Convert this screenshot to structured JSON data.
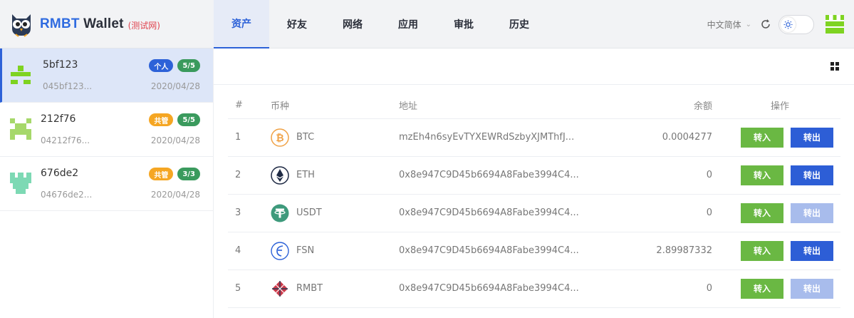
{
  "brand": {
    "title_a": "RMBT",
    "title_b": " Wallet",
    "network": "(测试网)"
  },
  "nav": {
    "tabs": [
      {
        "label": "资产"
      },
      {
        "label": "好友"
      },
      {
        "label": "网络"
      },
      {
        "label": "应用"
      },
      {
        "label": "审批"
      },
      {
        "label": "历史"
      }
    ]
  },
  "tools": {
    "language": "中文简体"
  },
  "accounts": [
    {
      "name": "5bf123",
      "address": "045bf123...",
      "date": "2020/04/28",
      "badge_type": "个人",
      "badge_count": "5/5"
    },
    {
      "name": "212f76",
      "address": "04212f76...",
      "date": "2020/04/28",
      "badge_type": "共管",
      "badge_count": "5/5"
    },
    {
      "name": "676de2",
      "address": "04676de2...",
      "date": "2020/04/28",
      "badge_type": "共管",
      "badge_count": "3/3"
    }
  ],
  "table": {
    "headers": {
      "num": "#",
      "coin": "币种",
      "address": "地址",
      "balance": "余额",
      "actions": "操作"
    },
    "rows": [
      {
        "num": "1",
        "coin": "BTC",
        "address": "mzEh4n6syEvTYXEWRdSzbyXJMThfJ...",
        "balance": "0.0004277"
      },
      {
        "num": "2",
        "coin": "ETH",
        "address": "0x8e947C9D45b6694A8Fabe3994C4...",
        "balance": "0"
      },
      {
        "num": "3",
        "coin": "USDT",
        "address": "0x8e947C9D45b6694A8Fabe3994C4...",
        "balance": "0"
      },
      {
        "num": "4",
        "coin": "FSN",
        "address": "0x8e947C9D45b6694A8Fabe3994C4...",
        "balance": "2.89987332"
      },
      {
        "num": "5",
        "coin": "RMBT",
        "address": "0x8e947C9D45b6694A8Fabe3994C4...",
        "balance": "0"
      }
    ],
    "btn_in": "转入",
    "btn_out": "转出"
  },
  "colors": {
    "accent": "#2d62d8",
    "in_button": "#6ab843",
    "out_button": "#2d5ed6",
    "out_disabled": "#a8bcec",
    "badge_personal": "#2d62d8",
    "badge_shared": "#f5a623",
    "badge_count": "#3a9a5d"
  }
}
